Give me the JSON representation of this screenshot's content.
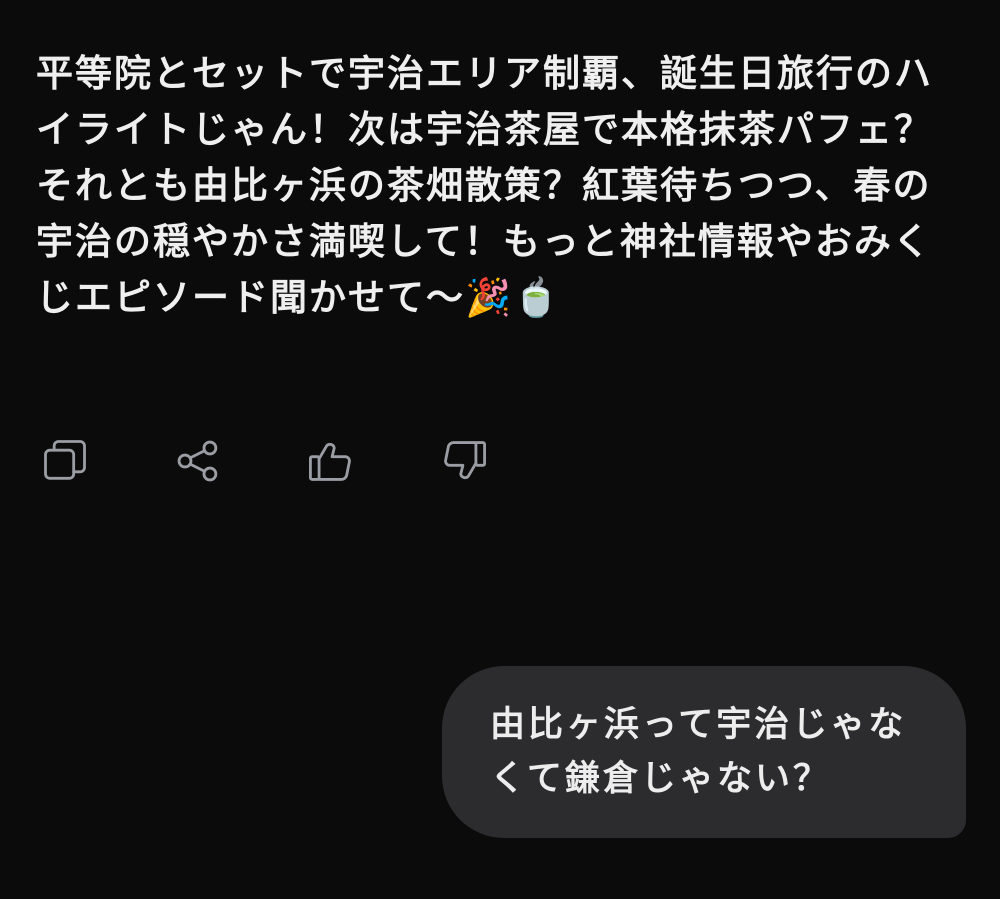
{
  "assistant": {
    "message": "平等院とセットで宇治エリア制覇、誕生日旅行のハイライトじゃん！次は宇治茶屋で本格抹茶パフェ？それとも由比ヶ浜の茶畑散策？紅葉待ちつつ、春の宇治の穏やかさ満喫して！もっと神社情報やおみくじエピソード聞かせて〜🎉🍵"
  },
  "actions": {
    "copy_icon": "copy-icon",
    "share_icon": "share-icon",
    "like_icon": "thumbs-up-icon",
    "dislike_icon": "thumbs-down-icon"
  },
  "user": {
    "message": "由比ヶ浜って宇治じゃなくて鎌倉じゃない？"
  }
}
